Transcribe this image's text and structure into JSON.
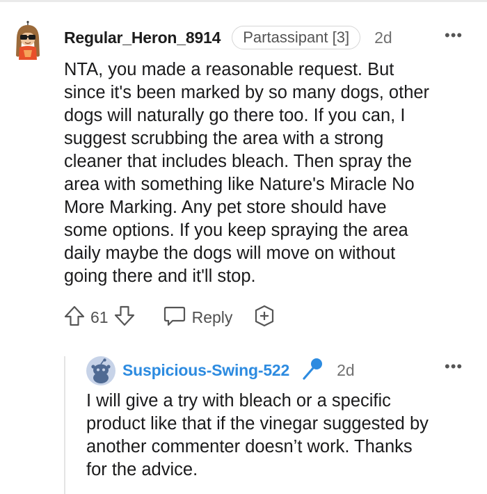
{
  "comment": {
    "username": "Regular_Heron_8914",
    "flair": "Partassipant [3]",
    "age": "2d",
    "more": "•••",
    "body_lines": [
      "NTA, you made a reasonable request. But",
      "since it's been marked by so many dogs, other",
      "dogs will naturally go there too. If you can, I",
      "suggest scrubbing the area with a strong",
      "cleaner that includes bleach. Then spray the",
      "area with something like Nature's Miracle No",
      "More Marking. Any pet store should have",
      "some options. If you keep spraying the area",
      "daily maybe the dogs will move on without",
      "going there and it'll stop."
    ],
    "votes": "61",
    "reply_label": "Reply",
    "icons": {
      "upvote": "arrow-up-icon",
      "downvote": "arrow-down-icon",
      "reply": "speech-bubble-icon",
      "award": "award-plus-icon"
    }
  },
  "reply": {
    "username": "Suspicious-Swing-522",
    "username_color": "#2d8be0",
    "badge_icon": "microphone-icon",
    "age": "2d",
    "more": "•••",
    "body_lines": [
      "I will give a try with bleach or a specific",
      "product like that if the vinegar suggested by",
      "another commenter doesn’t work. Thanks",
      "for the advice."
    ]
  }
}
